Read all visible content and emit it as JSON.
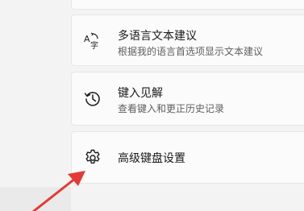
{
  "settings": {
    "items": [
      {
        "icon": "language-text-icon",
        "title": "多语言文本建议",
        "description": "根据我的语言首选项显示文本建议"
      },
      {
        "icon": "history-clock-icon",
        "title": "键入见解",
        "description": "查看键入和更正历史记录"
      },
      {
        "icon": "gear-icon",
        "title": "高级键盘设置"
      }
    ]
  },
  "annotation": {
    "arrow_color": "#e53935"
  }
}
